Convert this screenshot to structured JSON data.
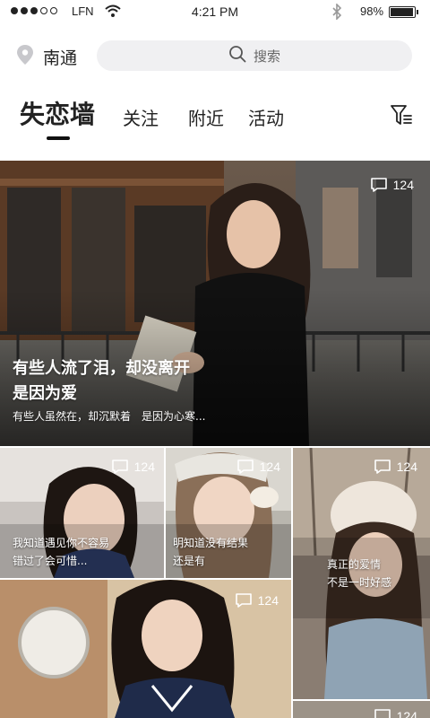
{
  "status_bar": {
    "carrier": "LFN",
    "time": "4:21 PM",
    "battery": "98%",
    "battery_level": 0.98
  },
  "header": {
    "location": "南通",
    "search_placeholder": "搜索"
  },
  "tabs": [
    {
      "label": "失恋墙",
      "active": true
    },
    {
      "label": "关注",
      "active": false
    },
    {
      "label": "附近",
      "active": false
    },
    {
      "label": "活动",
      "active": false
    }
  ],
  "feed": {
    "featured": {
      "comments": "124",
      "title_line1": "有些人流了泪，却没离开",
      "title_line2": "是因为爱",
      "subtitle": "有些人虽然在，却沉默着　是因为心寒..."
    },
    "tiles": [
      {
        "comments": "124",
        "title_line1": "我知道遇见你不容易",
        "title_line2": "错过了会可惜..."
      },
      {
        "comments": "124",
        "title_line1": "明知道没有结果",
        "title_line2": "还是有"
      },
      {
        "comments": "124",
        "title_line1": "真正的爱情",
        "title_line2": "不是一时好感"
      },
      {
        "comments": "124",
        "title_line1": "",
        "title_line2": ""
      },
      {
        "comments": "124",
        "title_line1": "",
        "title_line2": ""
      }
    ]
  }
}
